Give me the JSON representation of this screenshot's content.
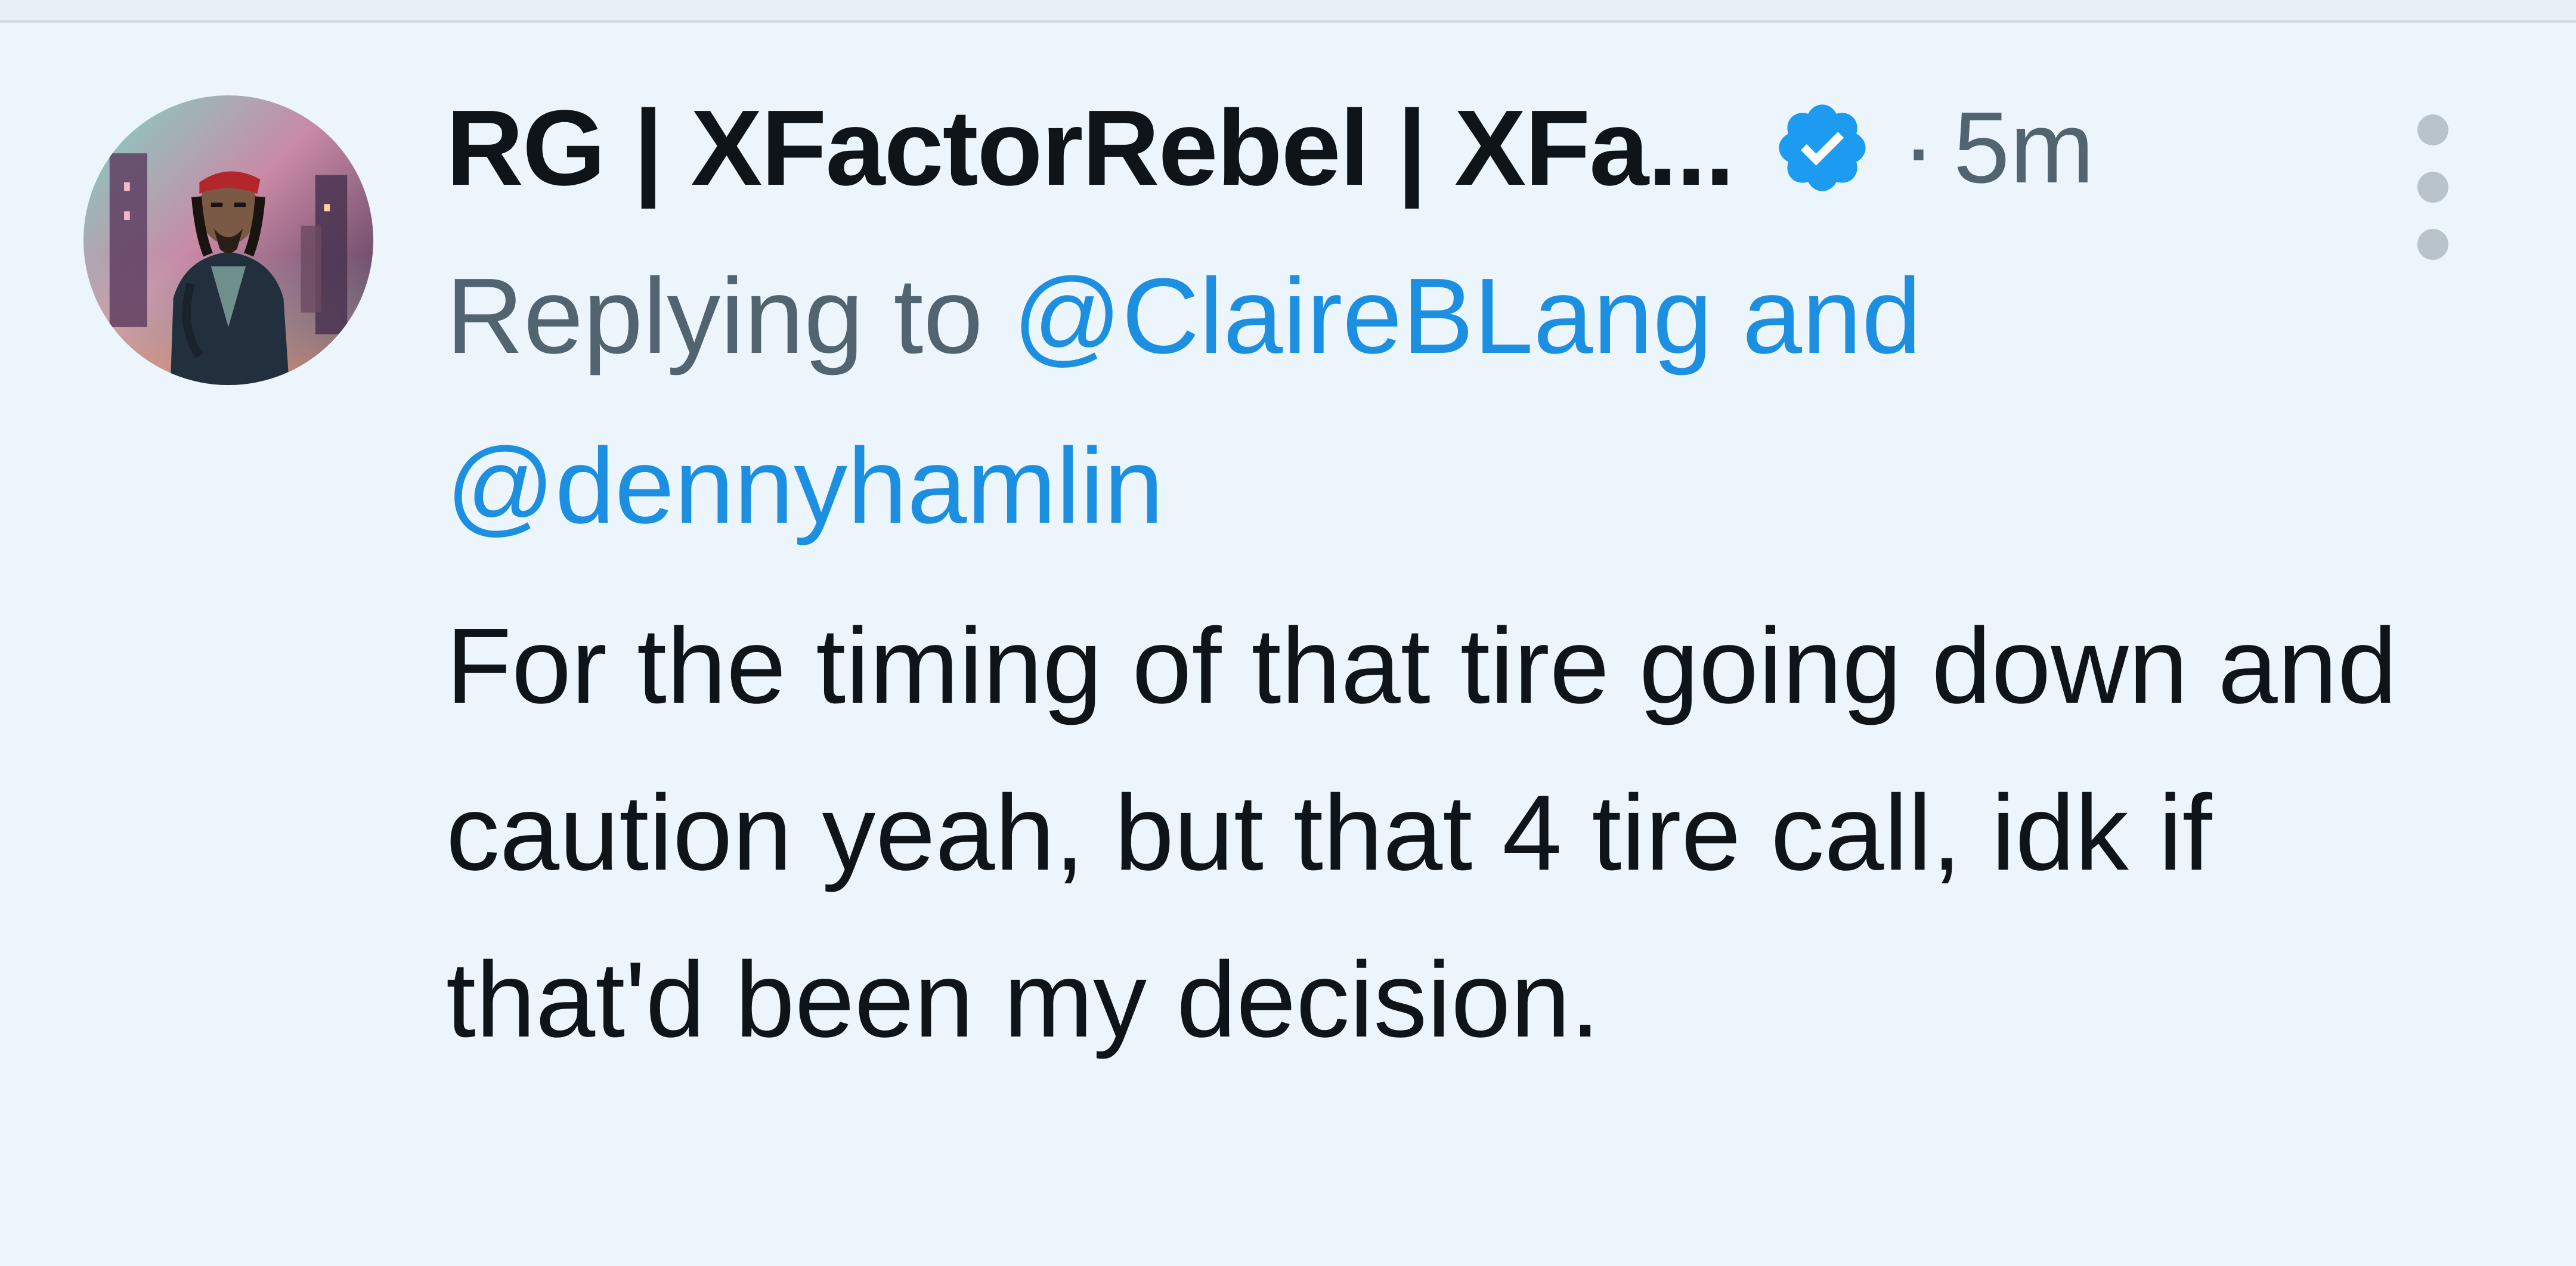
{
  "tweet": {
    "display_name": "RG | XFactorRebel | XFa...",
    "verified_icon": "verified-badge-icon",
    "separator": "·",
    "timestamp": "5m",
    "more_icon": "more-vertical-icon",
    "replying_prefix": "Replying to",
    "mention_1": "@ClaireBLang",
    "mention_joiner": "and",
    "mention_2": "@dennyhamlin",
    "text": "For the timing of that tire going down and caution yeah, but that 4 tire call, idk if that'd been my decision."
  },
  "colors": {
    "background": "#ecf5fc",
    "name": "#0f1419",
    "muted": "#536471",
    "link": "#1d8fe0",
    "verified": "#1d9bf0"
  }
}
